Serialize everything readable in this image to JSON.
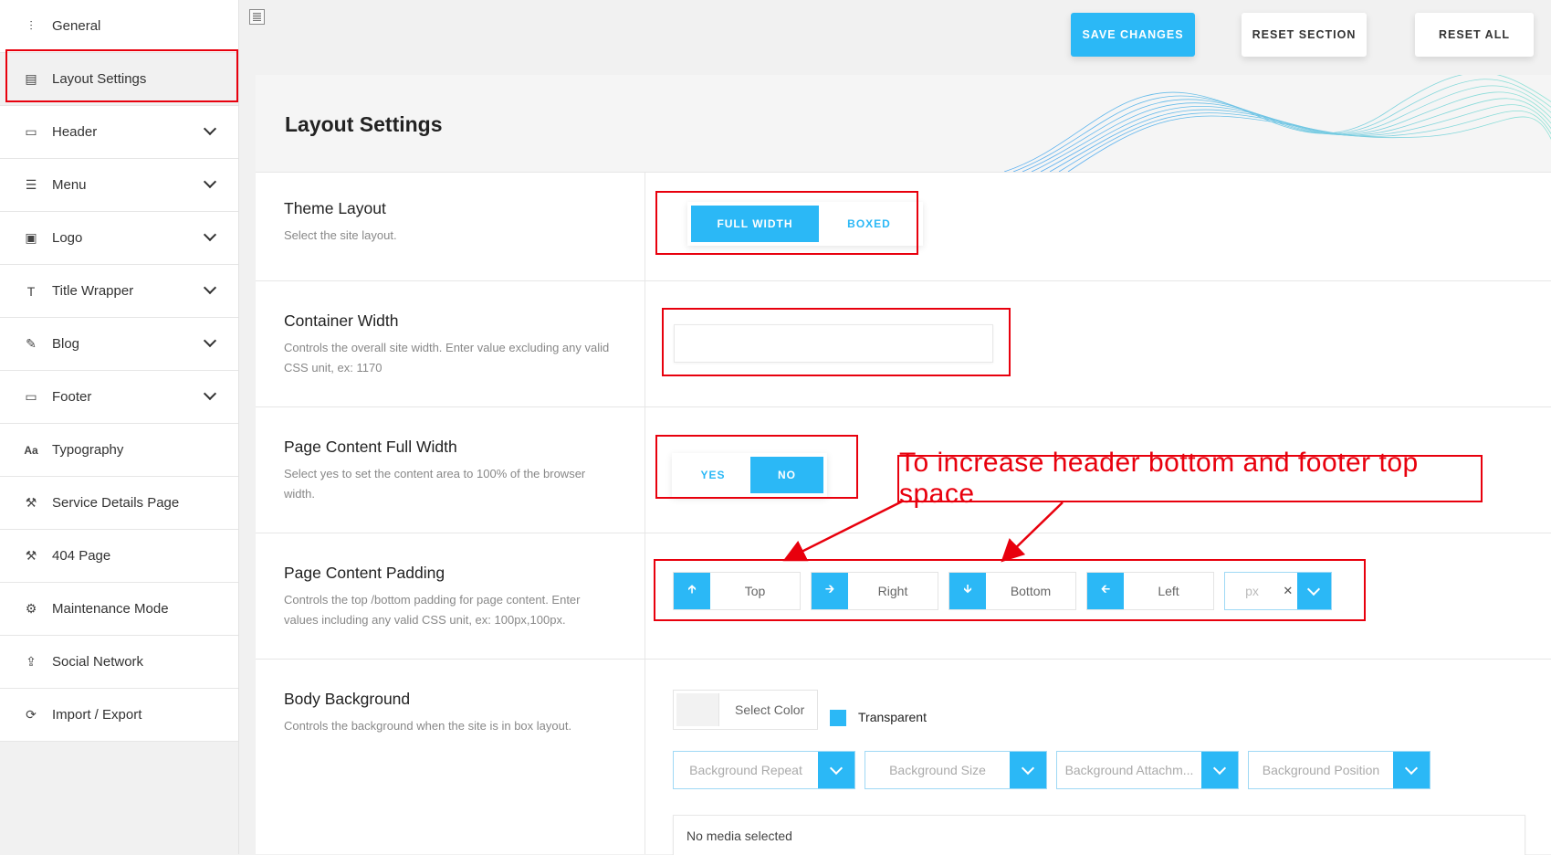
{
  "sidebar": {
    "items": [
      {
        "label": "General",
        "icon": "sliders-icon",
        "has_chevron": false
      },
      {
        "label": "Layout Settings",
        "icon": "layout-icon",
        "has_chevron": false,
        "active": true
      },
      {
        "label": "Header",
        "icon": "monitor-icon",
        "has_chevron": true
      },
      {
        "label": "Menu",
        "icon": "hamburger-icon",
        "has_chevron": true
      },
      {
        "label": "Logo",
        "icon": "image-icon",
        "has_chevron": true
      },
      {
        "label": "Title Wrapper",
        "icon": "text-icon",
        "has_chevron": true
      },
      {
        "label": "Blog",
        "icon": "edit-icon",
        "has_chevron": true
      },
      {
        "label": "Footer",
        "icon": "monitor-icon",
        "has_chevron": true
      },
      {
        "label": "Typography",
        "icon": "font-icon",
        "has_chevron": false
      },
      {
        "label": "Service Details Page",
        "icon": "wrench-icon",
        "has_chevron": false
      },
      {
        "label": "404 Page",
        "icon": "wrench-icon",
        "has_chevron": false
      },
      {
        "label": "Maintenance Mode",
        "icon": "cogs-icon",
        "has_chevron": false
      },
      {
        "label": "Social Network",
        "icon": "share-icon",
        "has_chevron": false
      },
      {
        "label": "Import / Export",
        "icon": "refresh-icon",
        "has_chevron": false
      }
    ]
  },
  "toolbar": {
    "save_label": "SAVE CHANGES",
    "reset_section_label": "RESET SECTION",
    "reset_all_label": "RESET ALL"
  },
  "page": {
    "title": "Layout Settings"
  },
  "theme_layout": {
    "title": "Theme Layout",
    "desc": "Select the site layout.",
    "options": [
      "FULL WIDTH",
      "BOXED"
    ],
    "selected": "FULL WIDTH"
  },
  "container_width": {
    "title": "Container Width",
    "desc": "Controls the overall site width. Enter value excluding any valid CSS unit, ex: 1170",
    "value": ""
  },
  "page_content_full_width": {
    "title": "Page Content Full Width",
    "desc": "Select yes to set the content area to 100% of the browser width.",
    "options": [
      "YES",
      "NO"
    ],
    "selected": "NO"
  },
  "page_content_padding": {
    "title": "Page Content Padding",
    "desc": "Controls the top /bottom padding for page content. Enter values including any valid CSS unit, ex: 100px,100px.",
    "fields": [
      "Top",
      "Right",
      "Bottom",
      "Left"
    ],
    "unit": "px"
  },
  "body_background": {
    "title": "Body Background",
    "desc": "Controls the background when the site is in box layout.",
    "color_label": "Select Color",
    "transparent_label": "Transparent",
    "selects": [
      "Background Repeat",
      "Background Size",
      "Background Attachm...",
      "Background Position"
    ],
    "media": "No media selected"
  },
  "annotation": {
    "text": "To increase header bottom and footer top space"
  },
  "colors": {
    "accent": "#2bb8f6",
    "annotation": "#e8000d"
  }
}
